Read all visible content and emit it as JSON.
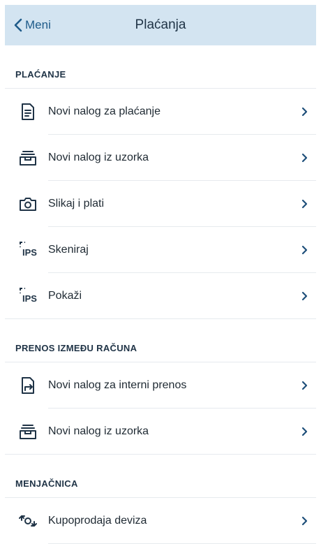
{
  "header": {
    "back_label": "Meni",
    "title": "Plaćanja"
  },
  "sections": [
    {
      "title": "PLAĆANJE",
      "items": [
        {
          "label": "Novi nalog za plaćanje",
          "icon": "document-icon"
        },
        {
          "label": "Novi nalog iz uzorka",
          "icon": "tray-stack-icon"
        },
        {
          "label": "Slikaj i plati",
          "icon": "camera-icon"
        },
        {
          "label": "Skeniraj",
          "icon": "ips-scan-icon"
        },
        {
          "label": "Pokaži",
          "icon": "ips-show-icon"
        }
      ]
    },
    {
      "title": "PRENOS IZMEĐU RAČUNA",
      "items": [
        {
          "label": "Novi nalog za interni prenos",
          "icon": "internal-transfer-icon"
        },
        {
          "label": "Novi nalog iz uzorka",
          "icon": "tray-stack-icon"
        }
      ]
    },
    {
      "title": "MENJAČNICA",
      "items": [
        {
          "label": "Kupoprodaja deviza",
          "icon": "currency-exchange-icon"
        }
      ]
    }
  ],
  "colors": {
    "header_bg": "#d3e4f1",
    "accent": "#1e5b8a",
    "chevron": "#1f4f7a"
  }
}
